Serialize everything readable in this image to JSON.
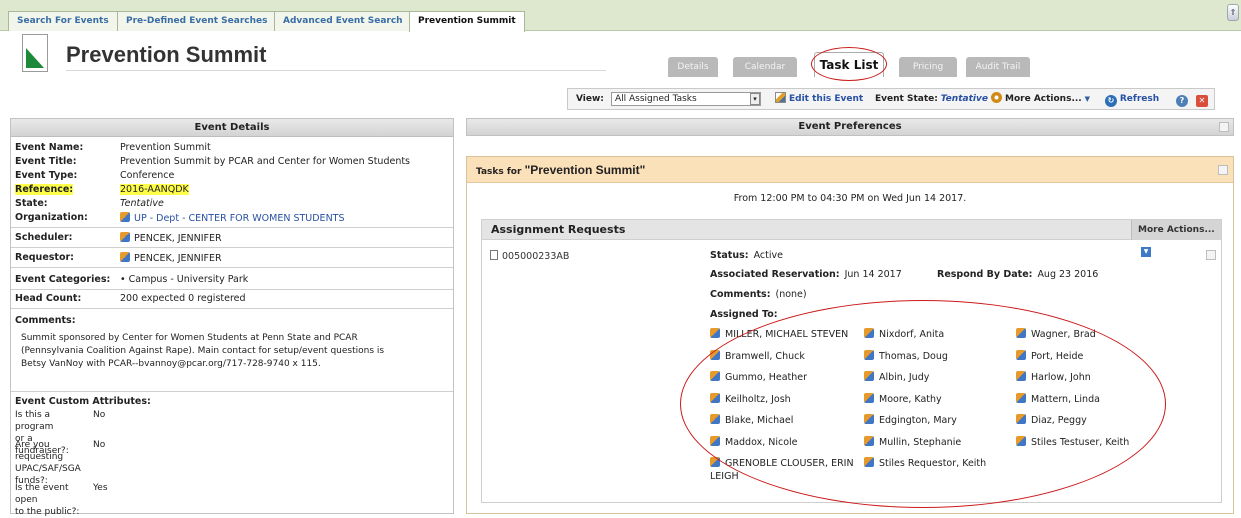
{
  "top_tabs": [
    "Search For Events",
    "Pre-Defined Event Searches",
    "Advanced Event Search",
    "Prevention Summit"
  ],
  "corner_button": "⇑",
  "header": {
    "title": "Prevention Summit"
  },
  "view_tabs": [
    "Details",
    "Calendar",
    "Task List",
    "Pricing",
    "Audit Trail"
  ],
  "toolbar": {
    "view_label": "View:",
    "view_value": "All Assigned Tasks",
    "edit_label": "Edit this Event",
    "state_label": "Event State:",
    "state_value": "Tentative",
    "more_actions": "More Actions...",
    "refresh": "Refresh"
  },
  "event_details": {
    "header": "Event Details",
    "fields": [
      {
        "label": "Event Name:",
        "value": "Prevention Summit"
      },
      {
        "label": "Event Title:",
        "value": "Prevention Summit by PCAR and Center for Women Students"
      },
      {
        "label": "Event Type:",
        "value": "Conference"
      },
      {
        "label": "Reference:",
        "value": "2016-AANQDK"
      },
      {
        "label": "State:",
        "value": "Tentative"
      },
      {
        "label": "Organization:",
        "value": "UP - Dept - CENTER FOR WOMEN STUDENTS"
      },
      {
        "label": "Scheduler:",
        "value": "PENCEK, JENNIFER"
      },
      {
        "label": "Requestor:",
        "value": "PENCEK, JENNIFER"
      },
      {
        "label": "Event Categories:",
        "value": "• Campus - University Park"
      },
      {
        "label": "Head Count:",
        "value": "200 expected 0 registered"
      }
    ],
    "comments_title": "Comments:",
    "comments_lines": [
      "Summit sponsored by Center for Women Students at Penn State and PCAR",
      "(Pennsylvania Coalition Against Rape). Main contact for setup/event questions is",
      "Betsy VanNoy with PCAR--bvannoy@pcar.org/717-728-9740 x 115."
    ],
    "custom_title": "Event Custom Attributes:",
    "custom": [
      {
        "q1": "Is this a program",
        "q2": "or a fundraiser?:",
        "a": "No"
      },
      {
        "q1": "Are you requesting",
        "q2": "UPAC/SAF/SGA",
        "q3": "funds?:",
        "a": "No"
      },
      {
        "q1": "Is the event open",
        "q2": "to the public?:",
        "a": "Yes"
      }
    ]
  },
  "preferences": {
    "header": "Event Preferences"
  },
  "tasks": {
    "prefix": "Tasks for",
    "title": "\"Prevention Summit\"",
    "time_line": "From 12:00 PM to 04:30 PM on Wed Jun 14 2017.",
    "assignment": {
      "header": "Assignment Requests",
      "more_actions": "More Actions...",
      "request_id": "005000233AB",
      "status_label": "Status:",
      "status_value": "Active",
      "reservation_label": "Associated Reservation:",
      "reservation_value": "Jun 14 2017",
      "respond_label": "Respond By Date:",
      "respond_value": "Aug 23 2016",
      "comments_label": "Comments:",
      "comments_value": "(none)",
      "assigned_label": "Assigned To:",
      "assignees": [
        "MILLER, MICHAEL STEVEN",
        "Nixdorf, Anita",
        "Wagner, Brad",
        "Bramwell, Chuck",
        "Thomas, Doug",
        "Port, Heide",
        "Gummo, Heather",
        "Albin, Judy",
        "Harlow, John",
        "Keilholtz, Josh",
        "Moore, Kathy",
        "Mattern, Linda",
        "Blake, Michael",
        "Edgington, Mary",
        "Diaz, Peggy",
        "Maddox, Nicole",
        "Mullin, Stephanie",
        "Stiles Testuser, Keith",
        "GRENOBLE CLOUSER, ERIN LEIGH",
        "Stiles Requestor, Keith"
      ]
    }
  },
  "colors": {
    "tab_strip": "#dde8cf",
    "tab_link": "#3a6ea5",
    "highlight": "#ffff4a",
    "tasks_header": "#fbe1b9",
    "annotation_red": "#cc1a1a"
  },
  "icons": [
    "document-icon",
    "pencil-icon",
    "gear-icon",
    "refresh-icon",
    "help-icon",
    "close-icon",
    "person-icon",
    "note-icon"
  ]
}
